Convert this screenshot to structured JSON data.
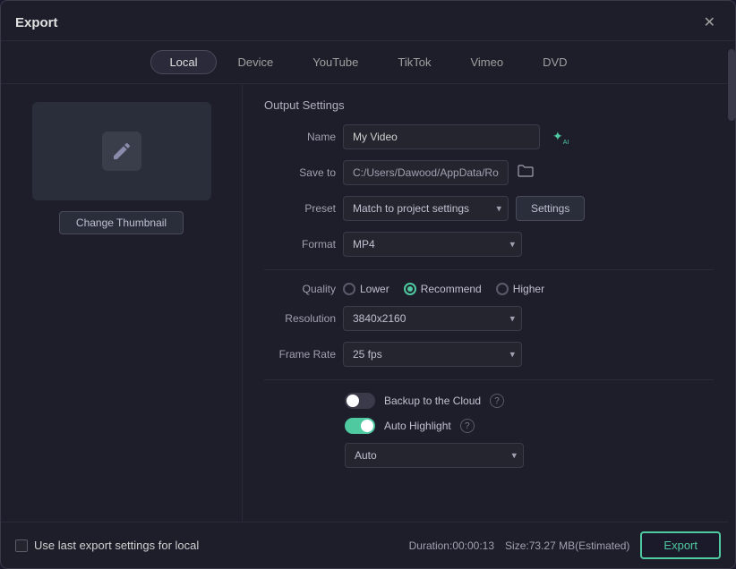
{
  "dialog": {
    "title": "Export",
    "close_label": "✕"
  },
  "tabs": [
    {
      "id": "local",
      "label": "Local",
      "active": true
    },
    {
      "id": "device",
      "label": "Device",
      "active": false
    },
    {
      "id": "youtube",
      "label": "YouTube",
      "active": false
    },
    {
      "id": "tiktok",
      "label": "TikTok",
      "active": false
    },
    {
      "id": "vimeo",
      "label": "Vimeo",
      "active": false
    },
    {
      "id": "dvd",
      "label": "DVD",
      "active": false
    }
  ],
  "thumbnail": {
    "change_label": "Change Thumbnail"
  },
  "output_settings": {
    "section_title": "Output Settings",
    "name_label": "Name",
    "name_value": "My Video",
    "save_to_label": "Save to",
    "save_to_value": "C:/Users/Dawood/AppData/Ro",
    "preset_label": "Preset",
    "preset_value": "Match to project settings",
    "settings_label": "Settings",
    "format_label": "Format",
    "format_value": "MP4",
    "quality_label": "Quality",
    "quality_options": [
      {
        "id": "lower",
        "label": "Lower",
        "checked": false
      },
      {
        "id": "recommend",
        "label": "Recommend",
        "checked": true
      },
      {
        "id": "higher",
        "label": "Higher",
        "checked": false
      }
    ],
    "resolution_label": "Resolution",
    "resolution_value": "3840x2160",
    "frame_rate_label": "Frame Rate",
    "frame_rate_value": "25 fps",
    "backup_label": "Backup to the Cloud",
    "backup_on": false,
    "auto_highlight_label": "Auto Highlight",
    "auto_highlight_on": true,
    "auto_select_label": "Auto",
    "auto_select_value": "Auto"
  },
  "bottom_bar": {
    "checkbox_label": "Use last export settings for local",
    "duration_label": "Duration:00:00:13",
    "size_label": "Size:73.27 MB(Estimated)",
    "export_label": "Export"
  },
  "icons": {
    "close": "✕",
    "ai": "✦",
    "folder": "📁",
    "chevron_down": "▾",
    "help": "?"
  }
}
